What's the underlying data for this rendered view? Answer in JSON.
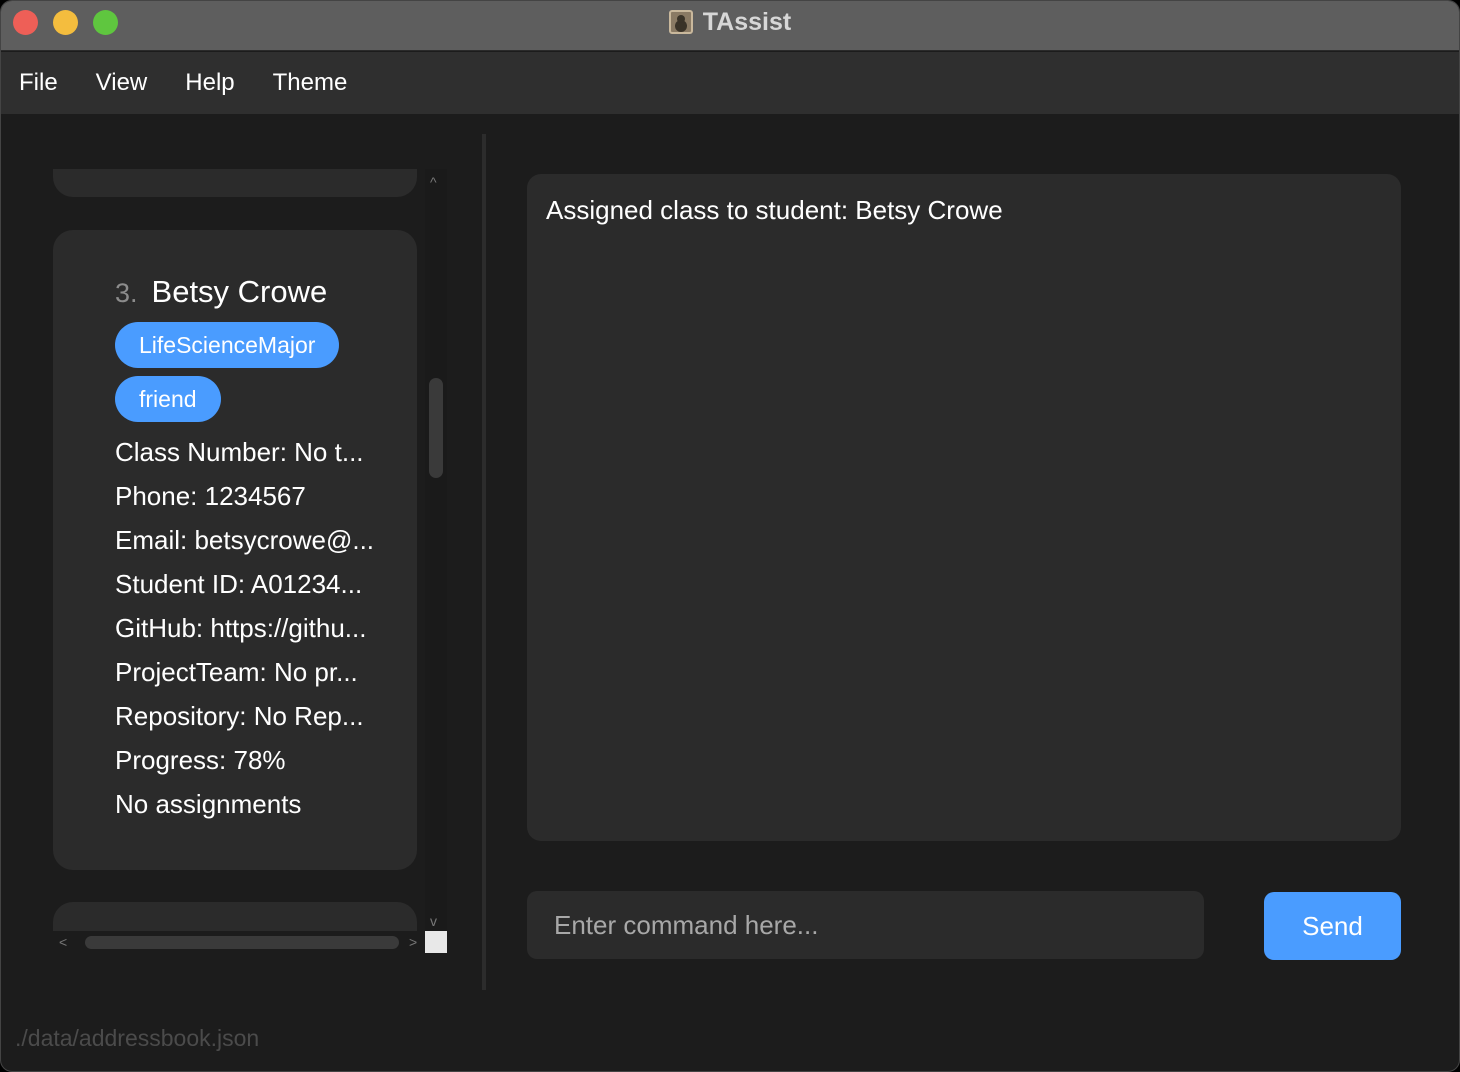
{
  "window": {
    "title": "TAssist",
    "app_icon": "address-book-icon"
  },
  "menu": [
    "File",
    "View",
    "Help",
    "Theme"
  ],
  "person_card": {
    "index": "3.",
    "name": "Betsy Crowe",
    "tags": [
      "LifeScienceMajor",
      "friend"
    ],
    "fields": [
      "Class Number: No t...",
      "Phone: 1234567",
      "Email: betsycrowe@...",
      "Student ID: A01234...",
      "GitHub: https://githu...",
      "ProjectTeam: No pr...",
      "Repository: No Rep...",
      "Progress: 78%",
      "No assignments"
    ]
  },
  "scroll_arrows": {
    "up": "^",
    "down": "v",
    "left": "<",
    "right": ">"
  },
  "result": {
    "text": "Assigned class to student: Betsy Crowe"
  },
  "command": {
    "placeholder": "Enter command here...",
    "value": ""
  },
  "send_button": {
    "label": "Send"
  },
  "status_bar": {
    "path": "./data/addressbook.json"
  },
  "colors": {
    "accent": "#4a9cff",
    "background": "#1c1c1c",
    "panel": "#2b2b2b",
    "close": "#ee5f57",
    "minimize": "#f4bd3e",
    "zoom": "#5fc63f"
  }
}
